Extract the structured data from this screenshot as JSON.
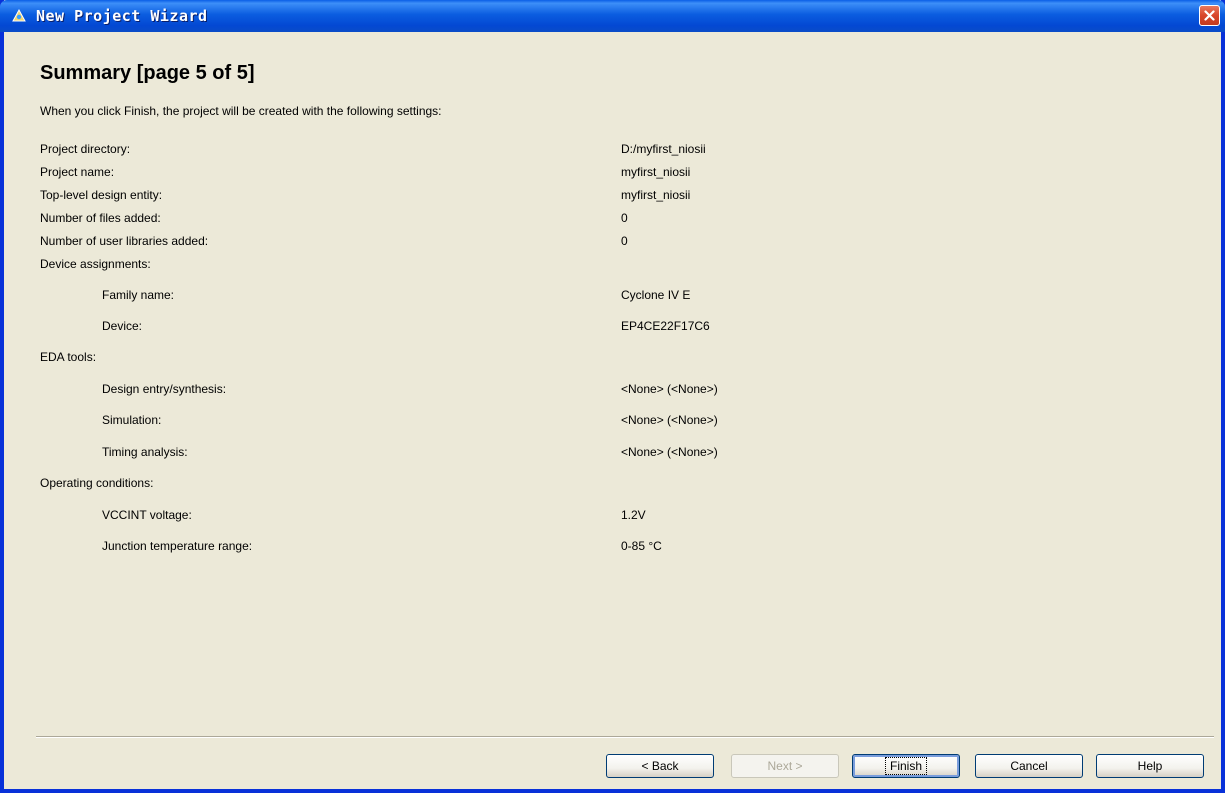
{
  "window": {
    "title": "New Project Wizard",
    "colors": {
      "titlebar": "#0b5de0",
      "face": "#ece9d8",
      "close": "#d8452a"
    }
  },
  "page": {
    "title": "Summary [page 5 of 5]",
    "intro": "When you click Finish, the project will be created with the following settings:"
  },
  "settings": [
    {
      "label": "Project directory:",
      "value": "D:/myfirst_niosii",
      "indent": false
    },
    {
      "label": "Project name:",
      "value": "myfirst_niosii",
      "indent": false
    },
    {
      "label": "Top-level design entity:",
      "value": "myfirst_niosii",
      "indent": false
    },
    {
      "label": "Number of files added:",
      "value": "0",
      "indent": false
    },
    {
      "label": "Number of user libraries added:",
      "value": "0",
      "indent": false
    },
    {
      "label": "Device assignments:",
      "value": "",
      "indent": false
    },
    {
      "label": "Family name:",
      "value": "Cyclone IV E",
      "indent": true
    },
    {
      "label": "Device:",
      "value": "EP4CE22F17C6",
      "indent": true
    },
    {
      "label": "EDA tools:",
      "value": "",
      "indent": false
    },
    {
      "label": "Design entry/synthesis:",
      "value": "<None> (<None>)",
      "indent": true
    },
    {
      "label": "Simulation:",
      "value": "<None> (<None>)",
      "indent": true
    },
    {
      "label": "Timing analysis:",
      "value": "<None> (<None>)",
      "indent": true
    },
    {
      "label": "Operating conditions:",
      "value": "",
      "indent": false
    },
    {
      "label": "VCCINT voltage:",
      "value": "1.2V",
      "indent": true
    },
    {
      "label": "Junction temperature range:",
      "value": "0-85 °C",
      "indent": true
    }
  ],
  "buttons": {
    "back": "< Back",
    "next": "Next >",
    "finish": "Finish",
    "cancel": "Cancel",
    "help": "Help"
  }
}
